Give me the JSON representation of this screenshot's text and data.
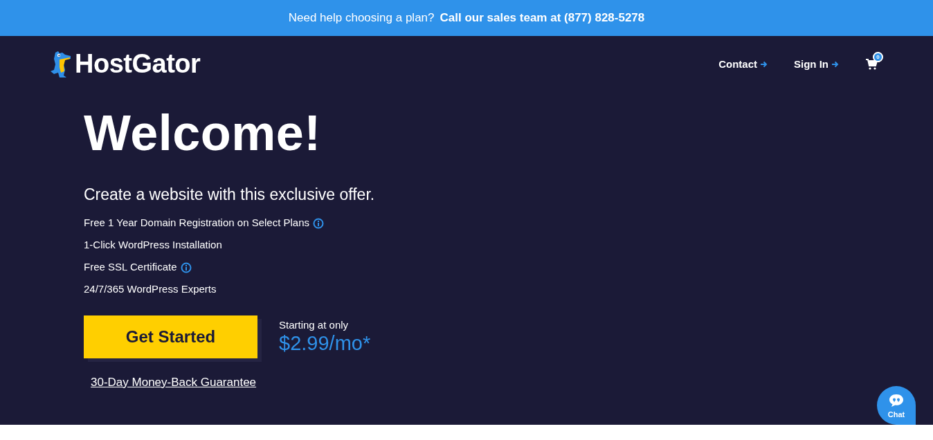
{
  "banner": {
    "text": "Need help choosing a plan?",
    "link": "Call our sales team at (877) 828-5278"
  },
  "header": {
    "logo": "HostGator",
    "links": [
      {
        "label": "Contact"
      },
      {
        "label": "Sign In"
      }
    ],
    "cart_count": "0"
  },
  "hero": {
    "title": "Welcome!",
    "subtitle": "Create a website with this exclusive offer.",
    "features": [
      {
        "text": "Free 1 Year Domain Registration on Select Plans",
        "info": true
      },
      {
        "text": "1-Click WordPress Installation",
        "info": false
      },
      {
        "text": "Free SSL Certificate",
        "info": true
      },
      {
        "text": "24/7/365 WordPress Experts",
        "info": false
      }
    ],
    "cta": "Get Started",
    "price_label": "Starting at only",
    "price": "$2.99/mo*",
    "guarantee": "30-Day Money-Back Guarantee"
  },
  "chat": {
    "label": "Chat"
  }
}
